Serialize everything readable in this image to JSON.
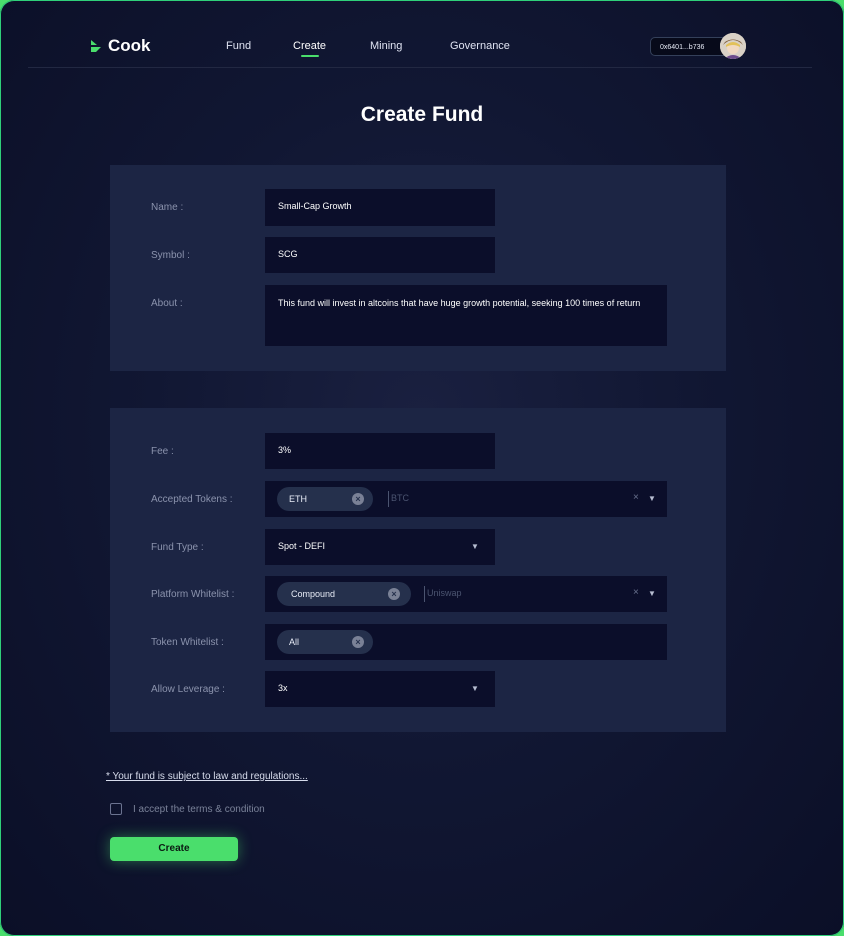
{
  "nav": {
    "brand": "Cook",
    "links": [
      "Fund",
      "Create",
      "Mining",
      "Governance"
    ],
    "active": "Create",
    "wallet": "0x6401...b736"
  },
  "page": {
    "title": "Create Fund"
  },
  "form": {
    "name": {
      "label": "Name :",
      "value": "Small-Cap Growth"
    },
    "symbol": {
      "label": "Symbol :",
      "value": "SCG"
    },
    "about": {
      "label": "About :",
      "value": "This fund will invest in altcoins that have huge growth potential, seeking 100 times of return"
    },
    "fee": {
      "label": "Fee :",
      "value": "3%"
    },
    "accepted_tokens": {
      "label": "Accepted Tokens :",
      "chips": [
        "ETH"
      ],
      "placeholder": "BTC"
    },
    "fund_type": {
      "label": "Fund Type :",
      "value": "Spot - DEFI"
    },
    "platform_whitelist": {
      "label": "Platform Whitelist :",
      "chips": [
        "Compound"
      ],
      "placeholder": "Uniswap"
    },
    "token_whitelist": {
      "label": "Token Whitelist :",
      "chips": [
        "All"
      ]
    },
    "allow_leverage": {
      "label": "Allow Leverage :",
      "value": "3x"
    }
  },
  "footer": {
    "notice": "* Your fund is subject to law and regulations...",
    "terms": "I accept the terms & condition",
    "create_button": "Create"
  },
  "icons": {
    "clear": "×",
    "caret": "▼",
    "remove": "×"
  },
  "colors": {
    "accent": "#4ade6c",
    "panel": "#1c2544",
    "field": "#0b0e2a"
  }
}
